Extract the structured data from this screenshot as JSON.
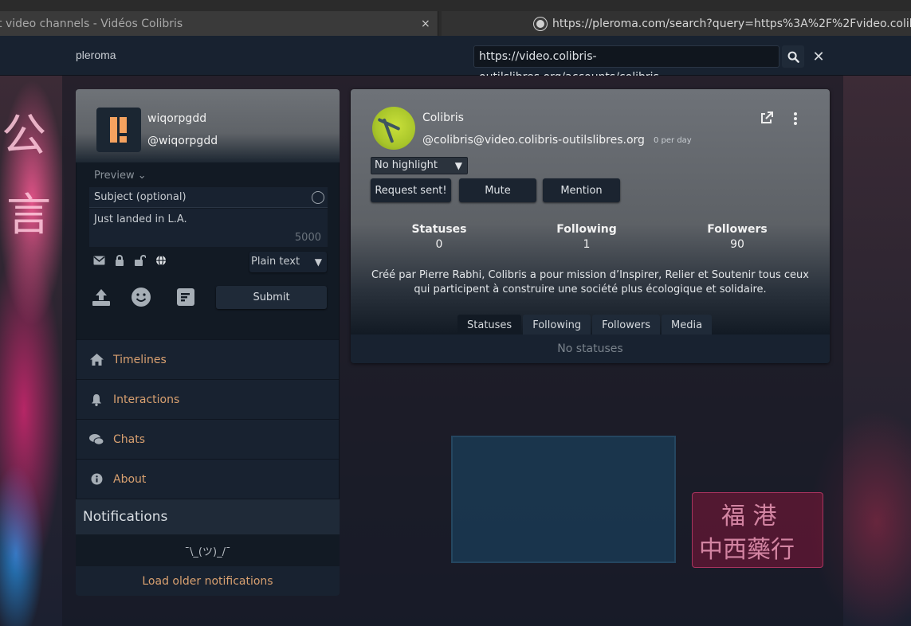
{
  "browser": {
    "tabs": [
      {
        "title": "t video channels - Vidéos Colibris",
        "close": "×"
      },
      {
        "title": "https://pleroma.com/search?query=https%3A%2F%2Fvideo.colibris-outilslibres.org"
      }
    ]
  },
  "topnav": {
    "brand": "pleroma",
    "search_value": "https://video.colibris-outilslibres.org/accounts/colibris",
    "close_label": "✕"
  },
  "user": {
    "name": "wiqorpgdd",
    "handle": "@wiqorpgdd"
  },
  "composer": {
    "preview_label": "Preview ⌄",
    "subject_placeholder": "Subject (optional)",
    "status_text": "Just landed in L.A.",
    "char_count": "5000",
    "format": "Plain text",
    "submit_label": "Submit"
  },
  "nav": {
    "items": [
      {
        "label": "Timelines",
        "icon": "home-icon"
      },
      {
        "label": "Interactions",
        "icon": "bell-icon"
      },
      {
        "label": "Chats",
        "icon": "chat-bubbles-icon"
      },
      {
        "label": "About",
        "icon": "info-icon"
      }
    ]
  },
  "notifications": {
    "title": "Notifications",
    "empty_text": "¯\\_(ツ)_/¯",
    "load_more": "Load older notifications"
  },
  "profile": {
    "name": "Colibris",
    "handle": "@colibris@video.colibris-outilslibres.org",
    "rate": "0 per day",
    "highlight": "No highlight",
    "buttons": {
      "request": "Request sent!",
      "mute": "Mute",
      "mention": "Mention"
    },
    "stats": [
      {
        "label": "Statuses",
        "value": "0"
      },
      {
        "label": "Following",
        "value": "1"
      },
      {
        "label": "Followers",
        "value": "90"
      }
    ],
    "bio": "Créé par Pierre Rabhi, Colibris a pour mission d’Inspirer, Relier et Soutenir tous ceux qui participent à construire une société plus écologique et solidaire.",
    "tabs": [
      "Statuses",
      "Following",
      "Followers",
      "Media"
    ],
    "empty_text": "No statuses"
  },
  "colors": {
    "accent": "#d8a070",
    "panel": "#182230",
    "background": "#121a24"
  }
}
